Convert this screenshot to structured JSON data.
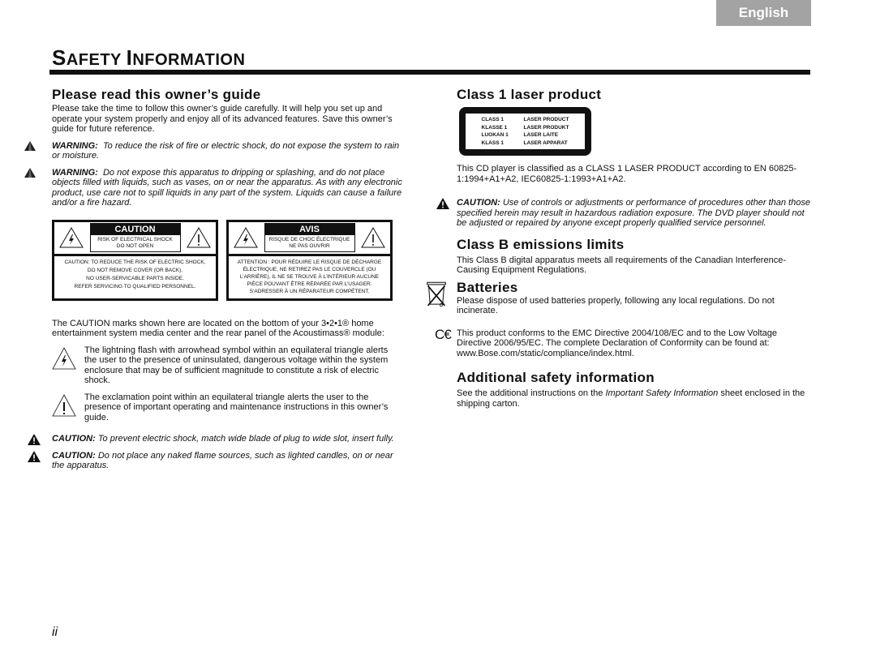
{
  "language_tab": "English",
  "page": {
    "title_first_cap": "S",
    "title_first_rest": "AFETY ",
    "title_second_cap": "I",
    "title_second_rest": "NFORMATION",
    "page_number": "ii"
  },
  "left": {
    "read_guide": {
      "heading": "Please read this owner’s guide",
      "body": "Please take the time to follow this owner’s guide carefully. It will help you set up and operate your system properly and enjoy all of its advanced features. Save this owner’s guide for future reference."
    },
    "warnings": [
      {
        "label": "WARNING:",
        "text": "To reduce the risk of fire or electric shock, do not expose the system to rain or moisture."
      },
      {
        "label": "WARNING:",
        "text": "Do not expose this apparatus to dripping or splashing, and do not place objects filled with liquids, such as vases, on or near the apparatus. As with any electronic product, use care not to spill liquids in any part of the system. Liquids can cause a failure and/or a fire hazard."
      }
    ],
    "caution_label": {
      "head": "CAUTION",
      "sub1": "RISK OF ELECTRICAL SHOCK",
      "sub2": "DO NOT OPEN",
      "lines": [
        "CAUTION: TO REDUCE THE RISK OF ELECTRIC SHOCK,",
        "DO NOT REMOVE COVER (OR BACK).",
        "NO USER-SERVICABLE PARTS INSIDE.",
        "REFER SERVICING TO QUALIFIED PERSONNEL."
      ]
    },
    "avis_label": {
      "head": "AVIS",
      "sub1": "RISQUE DE CHOC ÉLECTRIQUE",
      "sub2": "NE PAS OUVRIR",
      "lines": [
        "ATTENTION : POUR RÉDUIRE LE RISQUE DE DÉCHARGE",
        "ÉLECTRIQUE, NE RETIREZ PAS LE COUVERCLE (OU",
        "L’ARRIÈRE), IL NE SE TROUVE À L’INTÉRIEUR AUCUNE",
        "PIÈCE POUVANT ÊTRE RÉPARÉE PAR L’USAGER.",
        "S’ADRESSER À UN RÉPARATEUR COMPÉTENT."
      ]
    },
    "caution_marks_text": "The CAUTION marks shown here are located on the bottom of your 3•2•1® home entertainment system media center and the rear panel of the Acoustimass® module:",
    "symbols": [
      {
        "icon": "lightning-triangle-icon",
        "text": "The lightning flash with arrowhead symbol within an equilateral triangle alerts the user to the presence of uninsulated, dangerous voltage within the system enclosure that may be of sufficient magnitude to constitute a risk of electric shock."
      },
      {
        "icon": "exclamation-triangle-icon",
        "text": "The exclamation point within an equilateral triangle alerts the user to the presence of important operating and maintenance instructions in this owner’s guide."
      }
    ],
    "cautions": [
      {
        "label": "CAUTION:",
        "text": "To prevent electric shock, match wide blade of plug to wide slot, insert fully."
      },
      {
        "label": "CAUTION:",
        "text": "Do not place any naked flame sources, such as lighted candles, on or near the apparatus."
      }
    ]
  },
  "right": {
    "laser": {
      "heading": "Class 1 laser product",
      "rows": [
        [
          "CLASS 1",
          "LASER PRODUCT"
        ],
        [
          "KLASSE 1",
          "LASER PRODUKT"
        ],
        [
          "LUOKAN 1",
          "LASER LAITE"
        ],
        [
          "KLASS  1",
          "LASER APPARAT"
        ]
      ],
      "body": "This CD player is classified as a CLASS 1 LASER PRODUCT according to EN 60825-1:1994+A1+A2, IEC60825-1:1993+A1+A2.",
      "caution_label": "CAUTION:",
      "caution_text": "Use of controls or adjustments or performance of procedures other than those specified herein may result in hazardous radiation exposure. The DVD player should not be adjusted or repaired by anyone except properly qualified service personnel."
    },
    "emissions": {
      "heading": "Class B emissions limits",
      "body": "This Class B digital apparatus meets all requirements of the Canadian Interference-Causing Equipment Regulations."
    },
    "batteries": {
      "heading": "Batteries",
      "body": "Please dispose of used batteries properly, following any local regulations. Do not incinerate."
    },
    "ce": {
      "body": "This product conforms to the EMC Directive 2004/108/EC and to the Low Voltage Directive 2006/95/EC. The complete Declaration of Conformity can be found at: www.Bose.com/static/compliance/index.html."
    },
    "additional": {
      "heading": "Additional safety information",
      "body_pre": "See the additional instructions on the ",
      "body_italic": "Important Safety Information",
      "body_post": " sheet enclosed in the shipping carton."
    }
  }
}
